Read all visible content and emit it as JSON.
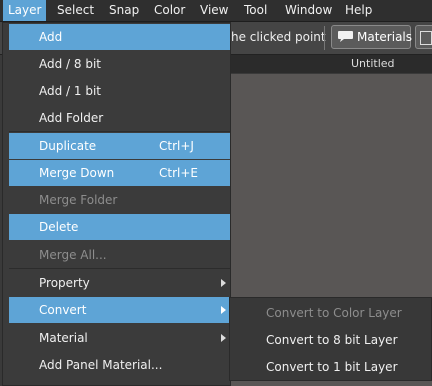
{
  "menubar": {
    "items": [
      "Layer",
      "Select",
      "Snap",
      "Color",
      "View",
      "Tool",
      "Window",
      "Help"
    ]
  },
  "toolbar": {
    "hint_text": "he clicked point",
    "materials_label": "Materials"
  },
  "document": {
    "title": "Untitled"
  },
  "layer_menu": {
    "add": "Add",
    "add_8bit": "Add / 8 bit",
    "add_1bit": "Add / 1 bit",
    "add_folder": "Add Folder",
    "duplicate": "Duplicate",
    "duplicate_shortcut": "Ctrl+J",
    "merge_down": "Merge Down",
    "merge_down_shortcut": "Ctrl+E",
    "merge_folder": "Merge Folder",
    "delete": "Delete",
    "merge_all": "Merge All...",
    "property": "Property",
    "convert": "Convert",
    "material": "Material",
    "add_panel_material": "Add Panel Material..."
  },
  "convert_submenu": {
    "to_color": "Convert to Color Layer",
    "to_8bit": "Convert to 8 bit Layer",
    "to_1bit": "Convert to 1 bit Layer"
  },
  "colors": {
    "highlight": "#5ea4d6",
    "menu_bg": "#3b3b3b",
    "disabled_text": "#8d8d8d",
    "canvas": "#595655"
  }
}
